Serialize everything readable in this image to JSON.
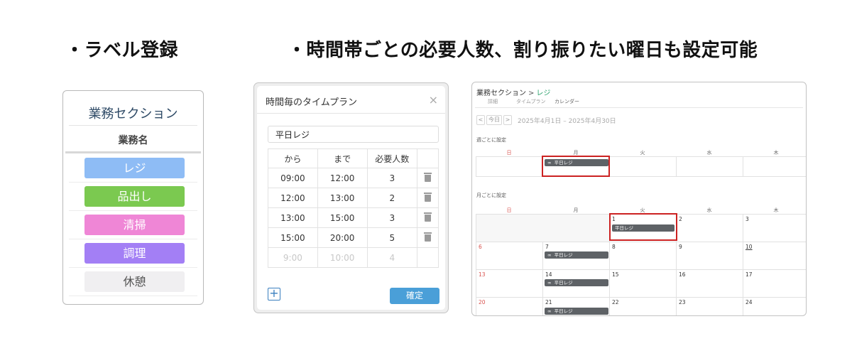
{
  "headings": {
    "label": "・ラベル登録",
    "time": "・時間帯ごとの必要人数、割り振りたい曜日も設定可能"
  },
  "label_panel": {
    "title": "業務セクション",
    "column_header": "業務名",
    "items": [
      {
        "label": "レジ",
        "color": "#8ebcf5",
        "text_color": "#ffffff"
      },
      {
        "label": "品出し",
        "color": "#7bc950",
        "text_color": "#ffffff"
      },
      {
        "label": "清掃",
        "color": "#ef86d6",
        "text_color": "#ffffff"
      },
      {
        "label": "調理",
        "color": "#a37ff5",
        "text_color": "#ffffff"
      },
      {
        "label": "休憩",
        "color": "#f0eff1",
        "text_color": "#555555"
      }
    ]
  },
  "plan_dialog": {
    "title": "時間毎のタイムプラン",
    "close_icon": "×",
    "name_value": "平日レジ",
    "headers": [
      "から",
      "まで",
      "必要人数"
    ],
    "rows": [
      [
        "09:00",
        "12:00",
        "3"
      ],
      [
        "12:00",
        "13:00",
        "2"
      ],
      [
        "13:00",
        "15:00",
        "3"
      ],
      [
        "15:00",
        "20:00",
        "5"
      ]
    ],
    "ghost_row": [
      "9:00",
      "10:00",
      "4"
    ],
    "add_icon": "+",
    "confirm_label": "確定"
  },
  "calendar": {
    "breadcrumb_parent": "業務セクション",
    "breadcrumb_arrow": ">",
    "breadcrumb_current": "レジ",
    "tabs": [
      "詳細",
      "タイムプラン",
      "カレンダー"
    ],
    "prev_label": "<",
    "today_label": "今日",
    "next_label": ">",
    "date_range": "2025年4月1日 – 2025年4月30日",
    "weekly_section_label": "週ごとに設定",
    "monthly_section_label": "月ごとに設定",
    "weekdays": [
      "日",
      "月",
      "火",
      "水",
      "木"
    ],
    "event_label": "平日レジ",
    "event_icon": "∞",
    "week_rows": [
      [
        "",
        "",
        "1",
        "2",
        "3"
      ],
      [
        "6",
        "7",
        "8",
        "9",
        "10"
      ],
      [
        "13",
        "14",
        "15",
        "16",
        "17"
      ],
      [
        "20",
        "21",
        "22",
        "23",
        "24"
      ]
    ],
    "highlight_color": "#cc2222",
    "sunday_color": "#d9534f"
  }
}
